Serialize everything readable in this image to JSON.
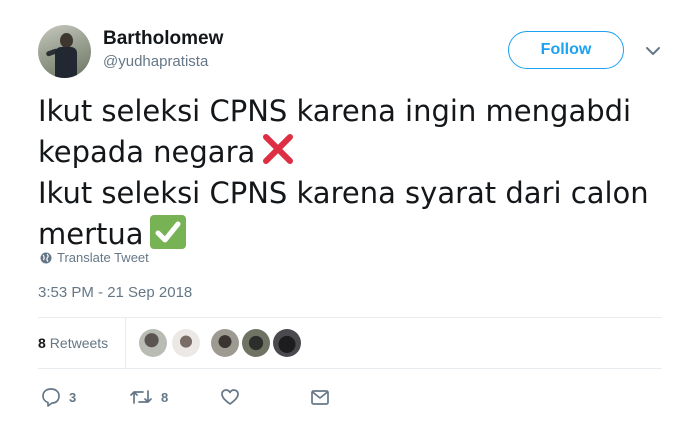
{
  "author": {
    "name": "Bartholomew",
    "handle": "@yudhapratista"
  },
  "header": {
    "follow_label": "Follow",
    "caret_icon": "chevron-down-icon"
  },
  "tweet": {
    "line1": "Ikut seleksi CPNS karena ingin mengabdi",
    "line2": "kepada negara",
    "line3": "Ikut seleksi CPNS karena syarat dari calon",
    "line4": "mertua",
    "emoji_cross": "cross-mark-emoji",
    "emoji_check": "check-mark-emoji"
  },
  "translate_label": "Translate Tweet",
  "timestamp": "3:53 PM - 21 Sep 2018",
  "stats": {
    "retweet_count": "8",
    "retweet_label": "Retweets"
  },
  "actions": {
    "reply_count": "3",
    "retweet_count": "8"
  },
  "colors": {
    "accent": "#1da1f2",
    "secondary_text": "#657786",
    "cross": "#dd2e44",
    "check": "#77b255"
  }
}
